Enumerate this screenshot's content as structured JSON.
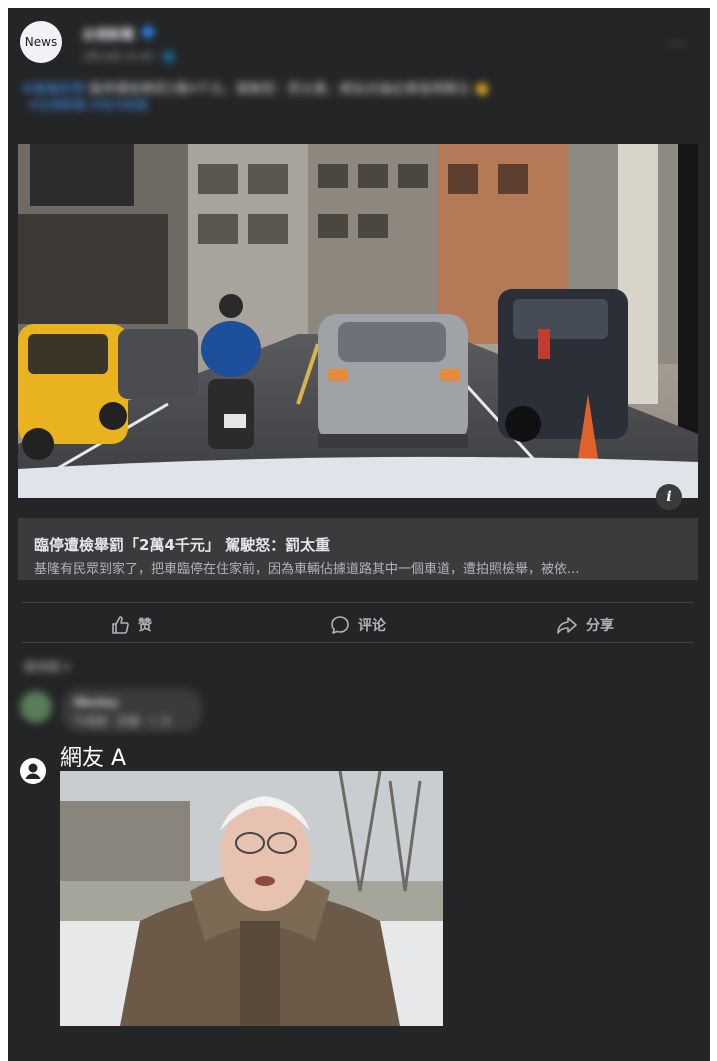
{
  "post": {
    "avatar_label": "News",
    "page_name": "台視新聞",
    "meta": "1月14日 21:43 · 🌐",
    "text_prefix": "#基隆民眾",
    "text_body": " 臨停遭檢舉罰2萬4千元，駕駛怒：罰太重，網友討論此事值得關注 👏",
    "text_line2": "#台視新聞 #地方新聞",
    "more_label": "···"
  },
  "link_preview": {
    "info_label": "i",
    "headline": "臨停遭檢舉罰「2萬4千元」 駕駛怒：罰太重",
    "snippet": "基隆有民眾到家了，把車臨停在住家前，因為車輛佔據道路其中一個車道，遭拍照檢舉，被依..."
  },
  "actions": {
    "like": "赞",
    "comment": "评论",
    "share": "分享"
  },
  "comments": {
    "sort_label": "最相關 ▾",
    "first": {
      "name": "Wesley",
      "text": "不需要 · 回覆 · 1 天"
    },
    "netizen_name": "網友 A"
  },
  "colors": {
    "card_bg": "#242526",
    "accent": "#2d88ff",
    "text_primary": "#e4e6eb",
    "text_secondary": "#b0b3b8"
  }
}
